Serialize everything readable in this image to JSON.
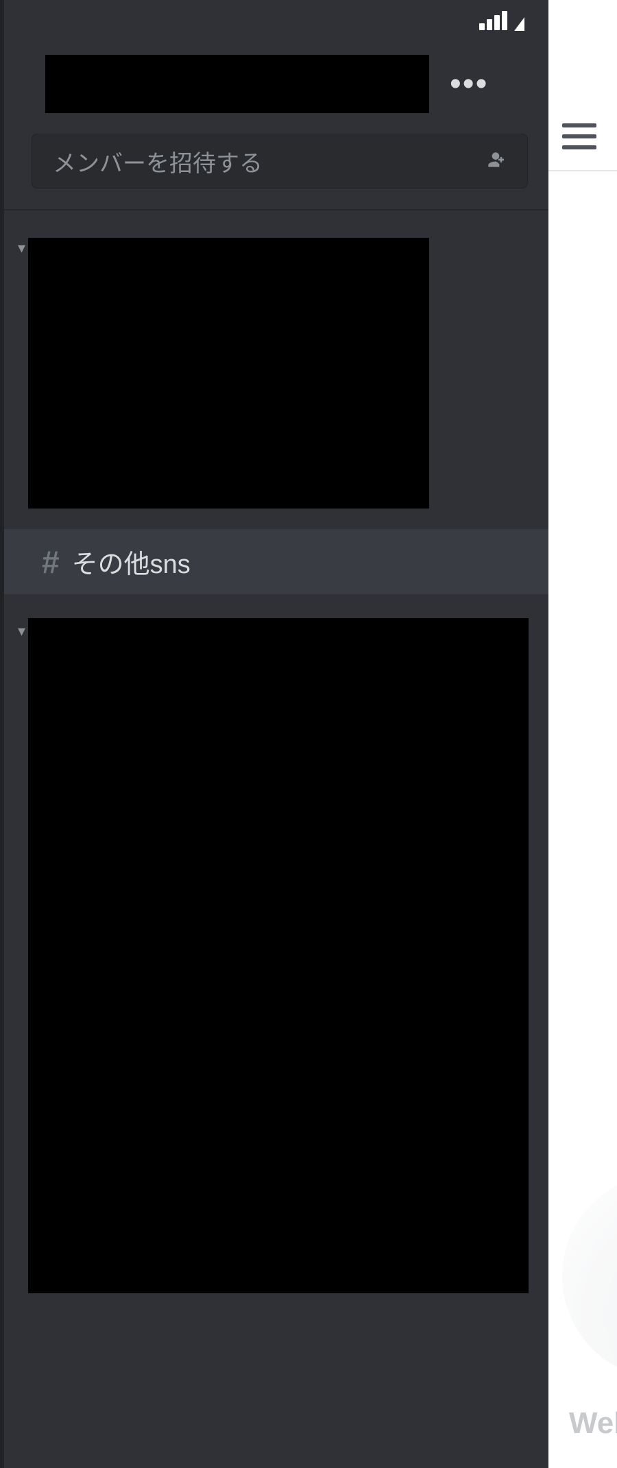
{
  "status_bar": {
    "signal_icon": "signal-icon",
    "wifi_icon": "wifi-icon"
  },
  "server": {
    "name_redacted": true,
    "more_label": "•••"
  },
  "invite": {
    "label": "メンバーを招待する",
    "icon": "add-user-icon"
  },
  "channels": {
    "redacted_category_a": true,
    "active_channel": {
      "hash": "#",
      "name": "その他sns"
    },
    "redacted_category_b": true
  },
  "main_peek": {
    "menu_icon": "hamburger-icon",
    "welcome_text": "Welcom"
  }
}
